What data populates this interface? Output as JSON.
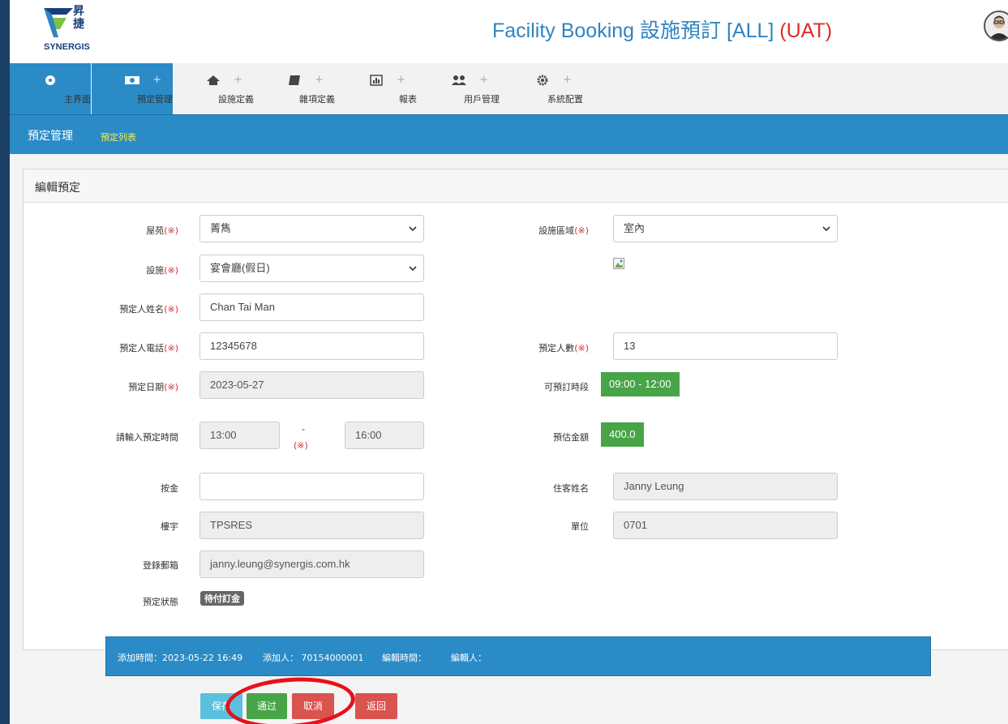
{
  "header": {
    "logo_cn": "昇\n捷",
    "logo_en": "SYNERGIS",
    "title": "Facility Booking 設施預訂 [ALL]",
    "env": "(UAT)"
  },
  "nav": {
    "items": [
      {
        "label": "主界面",
        "icon": "dashboard-icon"
      },
      {
        "label": "預定管理",
        "icon": "money-icon"
      },
      {
        "label": "設施定義",
        "icon": "home-icon"
      },
      {
        "label": "雜項定義",
        "icon": "book-icon"
      },
      {
        "label": "報表",
        "icon": "bar-chart-icon"
      },
      {
        "label": "用戶管理",
        "icon": "users-icon"
      },
      {
        "label": "系統配置",
        "icon": "gear-icon"
      }
    ],
    "plus": "+"
  },
  "breadcrumb": {
    "main": "預定管理",
    "sub": "預定列表"
  },
  "form": {
    "title": "編輯預定",
    "required_mark": "(※)",
    "estate_label": "屋苑",
    "estate_value": "菁雋",
    "area_label": "設施區域",
    "area_value": "室內",
    "facility_label": "設施",
    "facility_value": "宴會廳(假日)",
    "name_label": "預定人姓名",
    "name_value": "Chan Tai Man",
    "phone_label": "預定人電話",
    "phone_value": "12345678",
    "people_label": "預定人數",
    "people_value": "13",
    "date_label": "預定日期",
    "date_value": "2023-05-27",
    "slot_label": "可預訂時段",
    "slot_value": "09:00 - 12:00",
    "time_label": "請輸入預定時間",
    "time_start": "13:00",
    "time_dash": "-",
    "time_end": "16:00",
    "amount_label": "預估金額",
    "amount_value": "400.0",
    "deposit_label": "按金",
    "deposit_value": "",
    "resident_label": "住客姓名",
    "resident_value": "Janny Leung",
    "building_label": "樓宇",
    "building_value": "TPSRES",
    "unit_label": "單位",
    "unit_value": "0701",
    "email_label": "登錄郵箱",
    "email_value": "janny.leung@synergis.com.hk",
    "status_label": "預定狀態",
    "status_value": "待付訂金"
  },
  "info": {
    "added_time": "添加時間：2023-05-22 16:49",
    "added_by": "添加人： 70154000001",
    "edited_time": "編輯時間：",
    "edited_by": "編輯人："
  },
  "buttons": {
    "save": "保存",
    "approve": "通过",
    "cancel": "取消",
    "back": "返回"
  },
  "colors": {
    "primary": "#2a8bc7",
    "success": "#47a447",
    "danger": "#d9534f",
    "info": "#5bc0de",
    "title": "#2f84c2",
    "uat": "#e02b2b",
    "annotation": "#e8101a"
  }
}
